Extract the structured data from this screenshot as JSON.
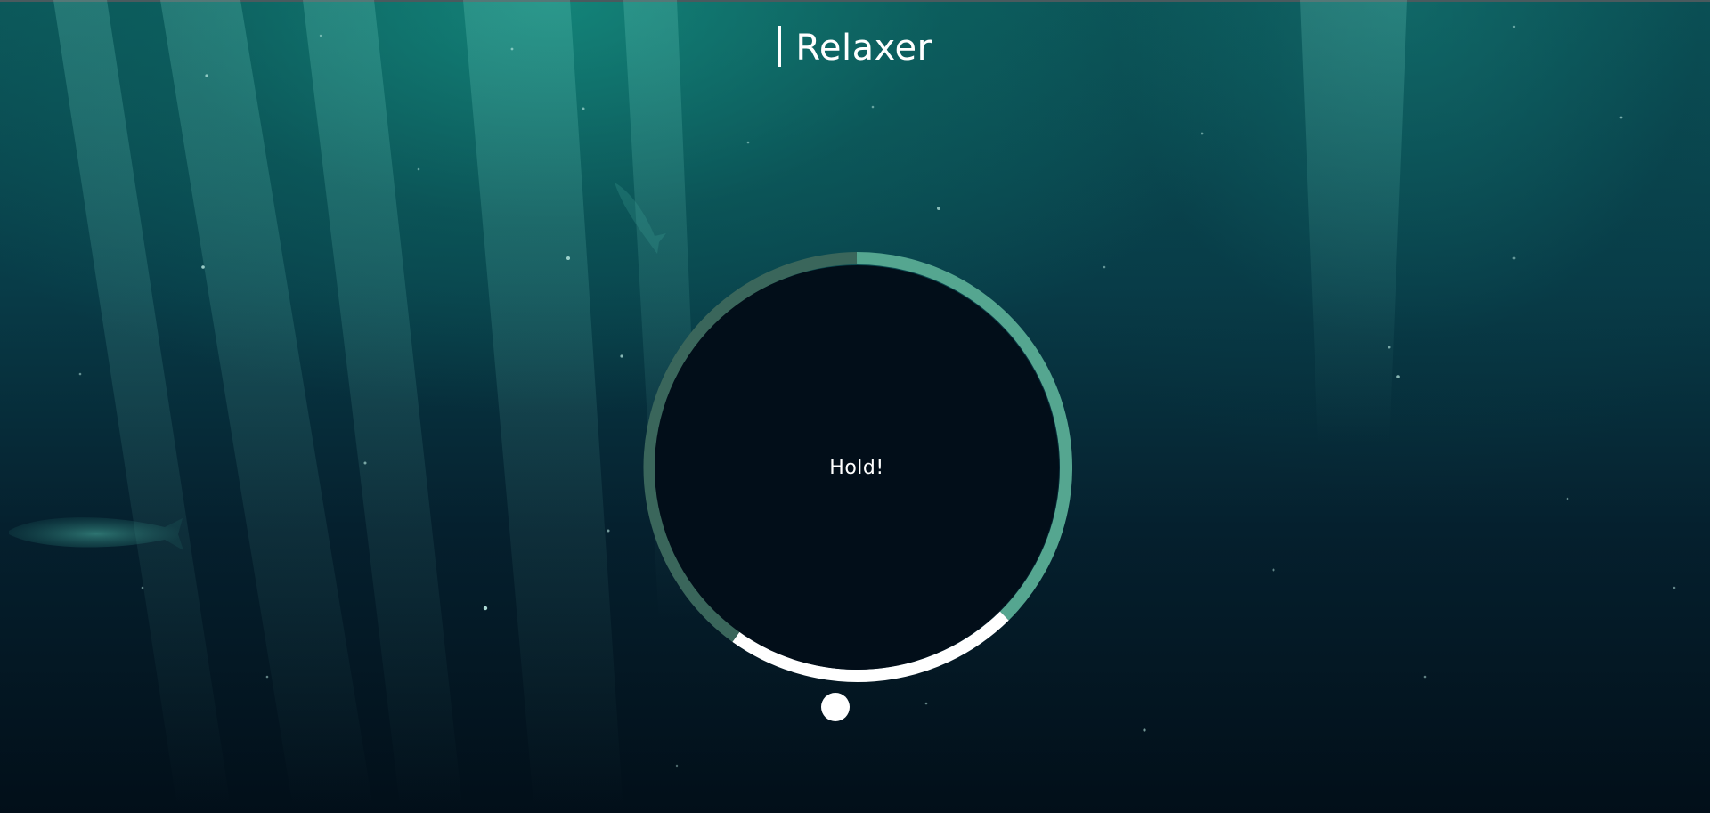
{
  "app": {
    "title": "Relaxer"
  },
  "breathing": {
    "status": "Hold!",
    "phases": [
      {
        "name": "breathe-in",
        "color": "#55a690"
      },
      {
        "name": "hold",
        "color": "#ffffff"
      },
      {
        "name": "breathe-out",
        "color": "#3a665b"
      }
    ]
  },
  "colors": {
    "background_dark": "#020f19",
    "inner_circle": "#020e19",
    "accent_teal": "#55a690",
    "accent_dark_teal": "#3a665b",
    "text": "#ffffff"
  }
}
